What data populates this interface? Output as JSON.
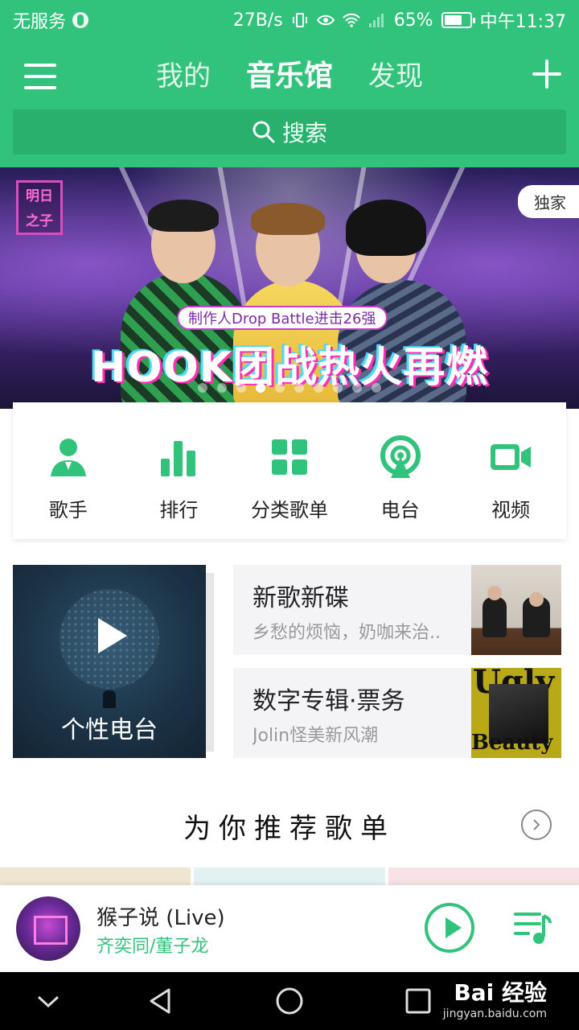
{
  "status_bar": {
    "carrier": "无服务",
    "speed": "27B/s",
    "battery_percent": "65%",
    "time": "中午11:37"
  },
  "nav": {
    "tabs": [
      {
        "label": "我的",
        "active": false
      },
      {
        "label": "音乐馆",
        "active": true
      },
      {
        "label": "发现",
        "active": false
      }
    ],
    "search_label": "搜索",
    "accent_color": "#31c27c"
  },
  "banner": {
    "logo_text": "明日之子",
    "badge": "独家",
    "subtitle": "制作人Drop Battle进击26强",
    "title": "HOOK团战热火再燃",
    "slide_count": 10,
    "active_slide": 4
  },
  "categories": [
    {
      "label": "歌手",
      "icon": "singer-icon"
    },
    {
      "label": "排行",
      "icon": "chart-bars-icon"
    },
    {
      "label": "分类歌单",
      "icon": "grid-icon"
    },
    {
      "label": "电台",
      "icon": "radio-icon"
    },
    {
      "label": "视频",
      "icon": "video-icon"
    }
  ],
  "feature": {
    "radio_label": "个性电台",
    "cards": [
      {
        "title": "新歌新碟",
        "subtitle": "乡愁的烦恼，奶咖来治.."
      },
      {
        "title": "数字专辑·票务",
        "subtitle": "Jolin怪美新风潮"
      }
    ],
    "album_words": [
      "Ugly",
      "Beauty"
    ]
  },
  "section": {
    "title": "为你推荐歌单"
  },
  "player": {
    "song": "猴子说 (Live)",
    "artist": "齐奕同/董子龙"
  },
  "watermark": {
    "main": "Bai 经验",
    "sub": "jingyan.baidu.com"
  }
}
